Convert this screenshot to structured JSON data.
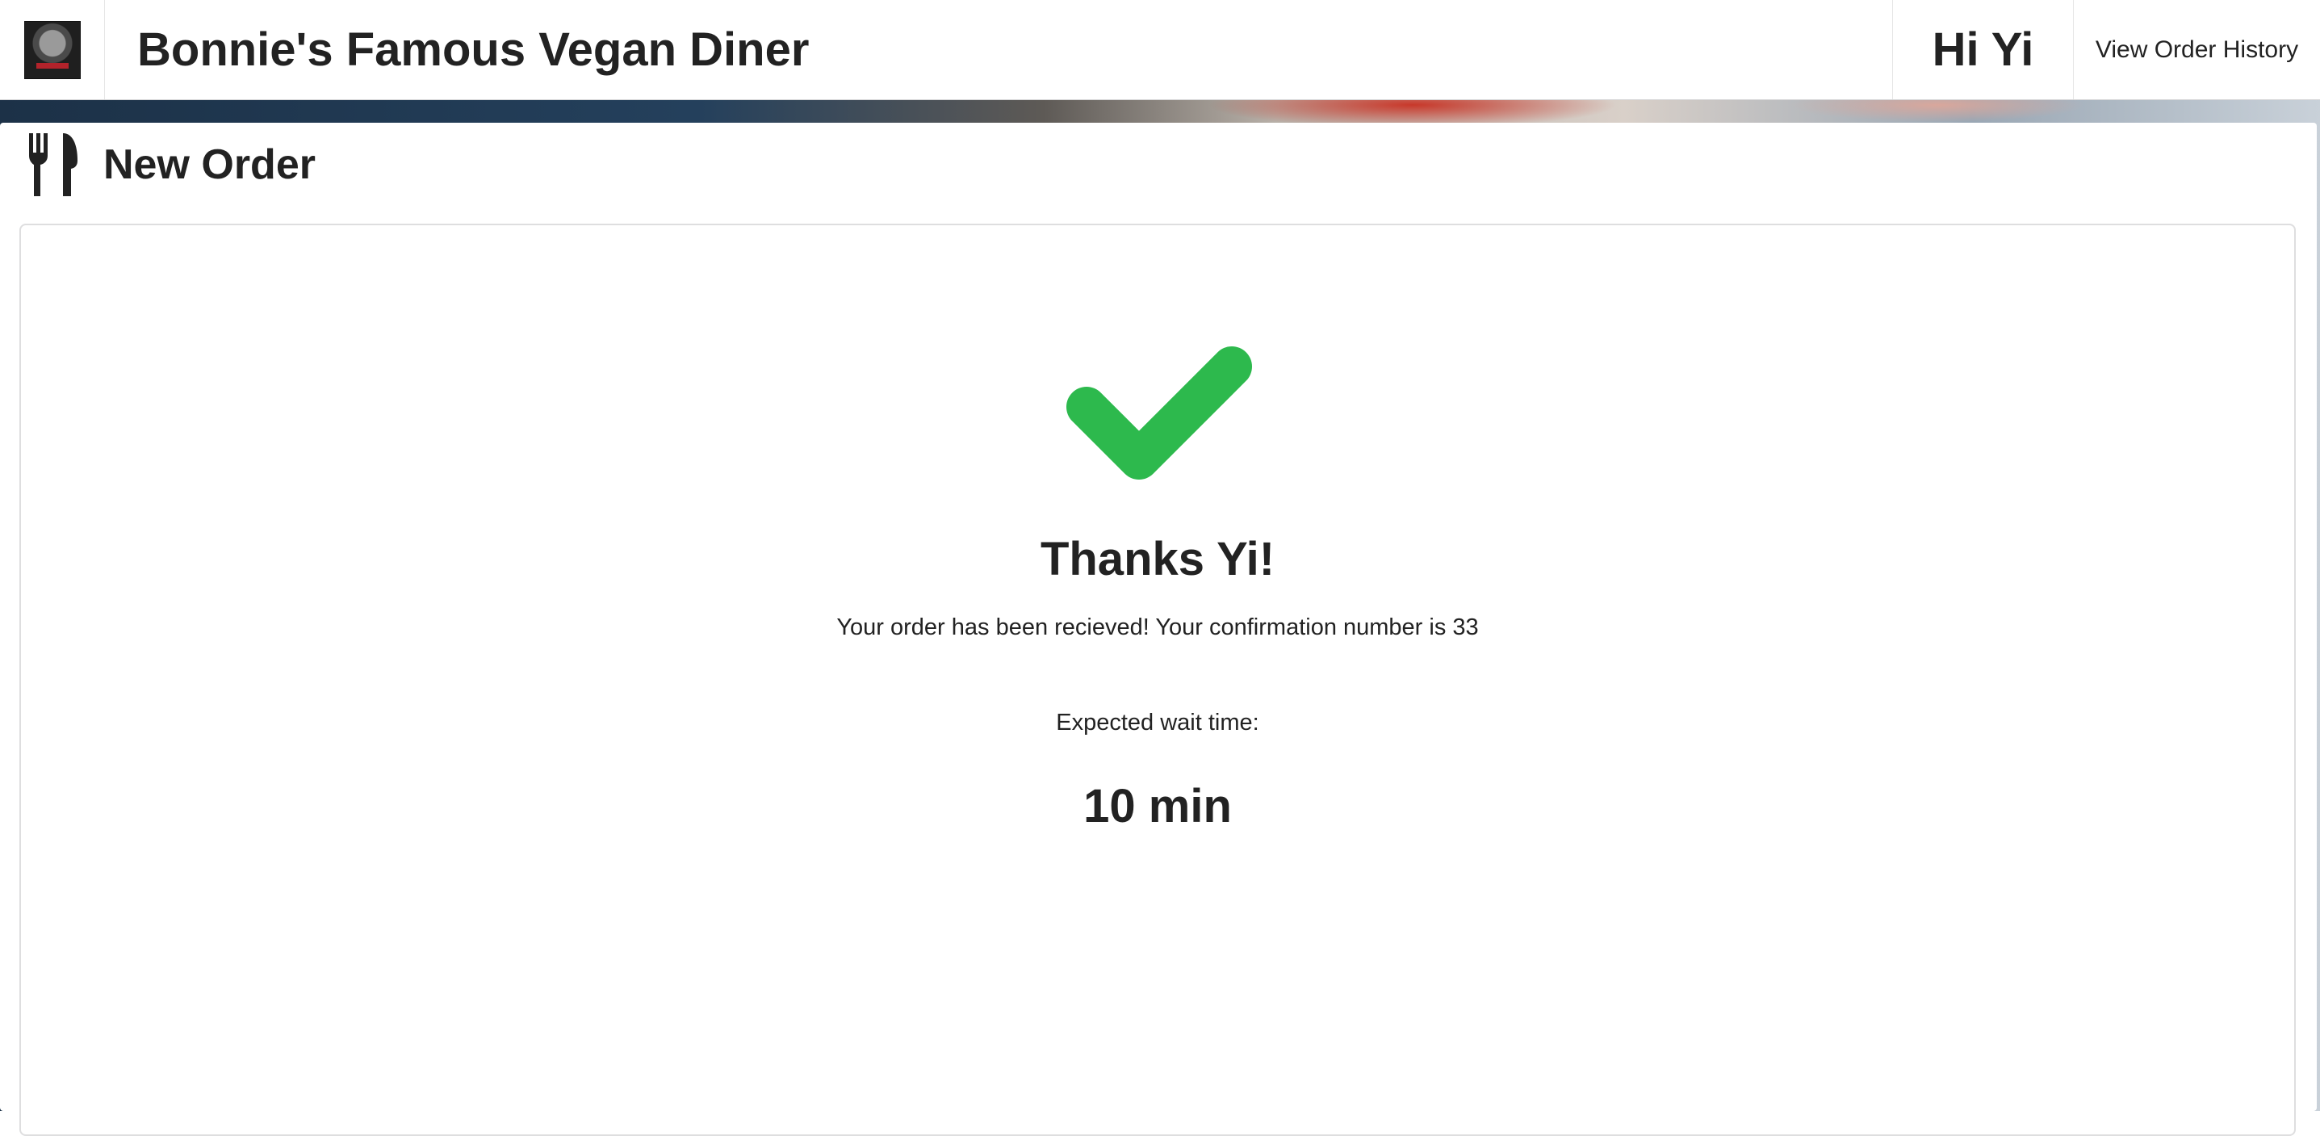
{
  "header": {
    "logo_icon": "bonnies-diner-logo",
    "site_title": "Bonnie's Famous Vegan Diner",
    "greeting": "Hi Yi",
    "order_history_link": "View Order History"
  },
  "page": {
    "title": "New Order",
    "title_icon": "utensils-icon"
  },
  "confirmation": {
    "status_icon": "checkmark-icon",
    "status_color": "#2db94d",
    "thanks": "Thanks Yi!",
    "message": "Your order has been recieved! Your confirmation number is 33",
    "wait_label": "Expected wait time:",
    "wait_value": "10 min"
  }
}
